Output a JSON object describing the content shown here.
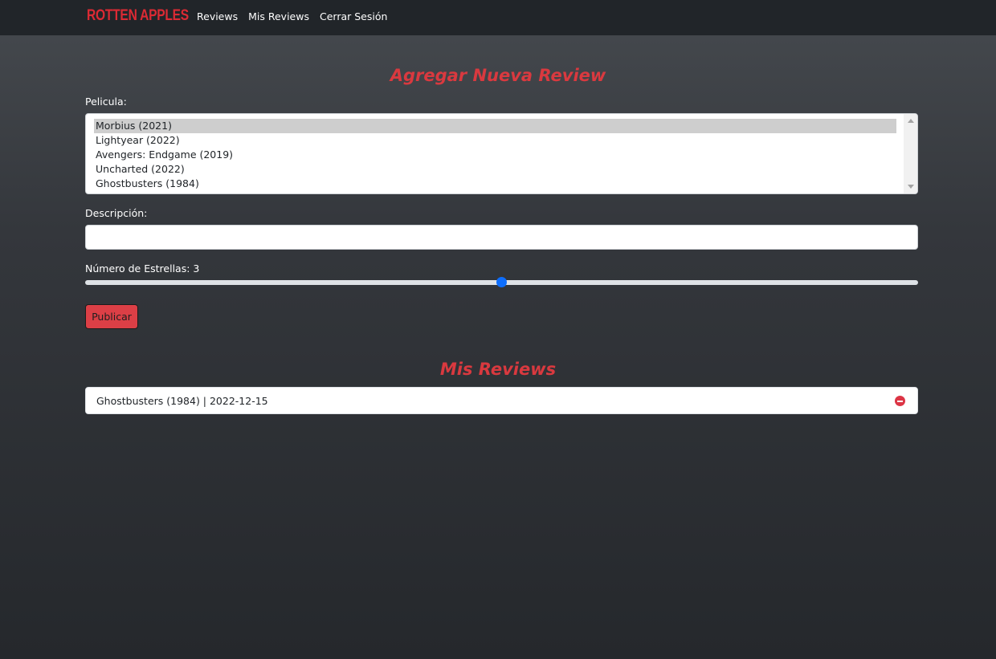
{
  "navbar": {
    "brand": "ROTTEN APPLES",
    "links": [
      "Reviews",
      "Mis Reviews",
      "Cerrar Sesión"
    ]
  },
  "form": {
    "title": "Agregar Nueva Review",
    "movie_label": "Pelicula:",
    "movies": [
      "Morbius (2021)",
      "Lightyear (2022)",
      "Avengers: Endgame (2019)",
      "Uncharted (2022)",
      "Ghostbusters (1984)"
    ],
    "selected_movie": "Morbius (2021)",
    "description_label": "Descripción:",
    "description_value": "",
    "stars_label": "Número de Estrellas:",
    "stars_value": "3",
    "stars_min": 1,
    "stars_max": 5,
    "publish_label": "Publicar"
  },
  "my_reviews": {
    "title": "Mis Reviews",
    "items": [
      {
        "text": "Ghostbusters (1984) | 2022-12-15"
      }
    ]
  },
  "colors": {
    "accent": "#d9393f",
    "navbar": "#212529",
    "slider_thumb": "#0d6efd",
    "delete": "#dc3545"
  }
}
